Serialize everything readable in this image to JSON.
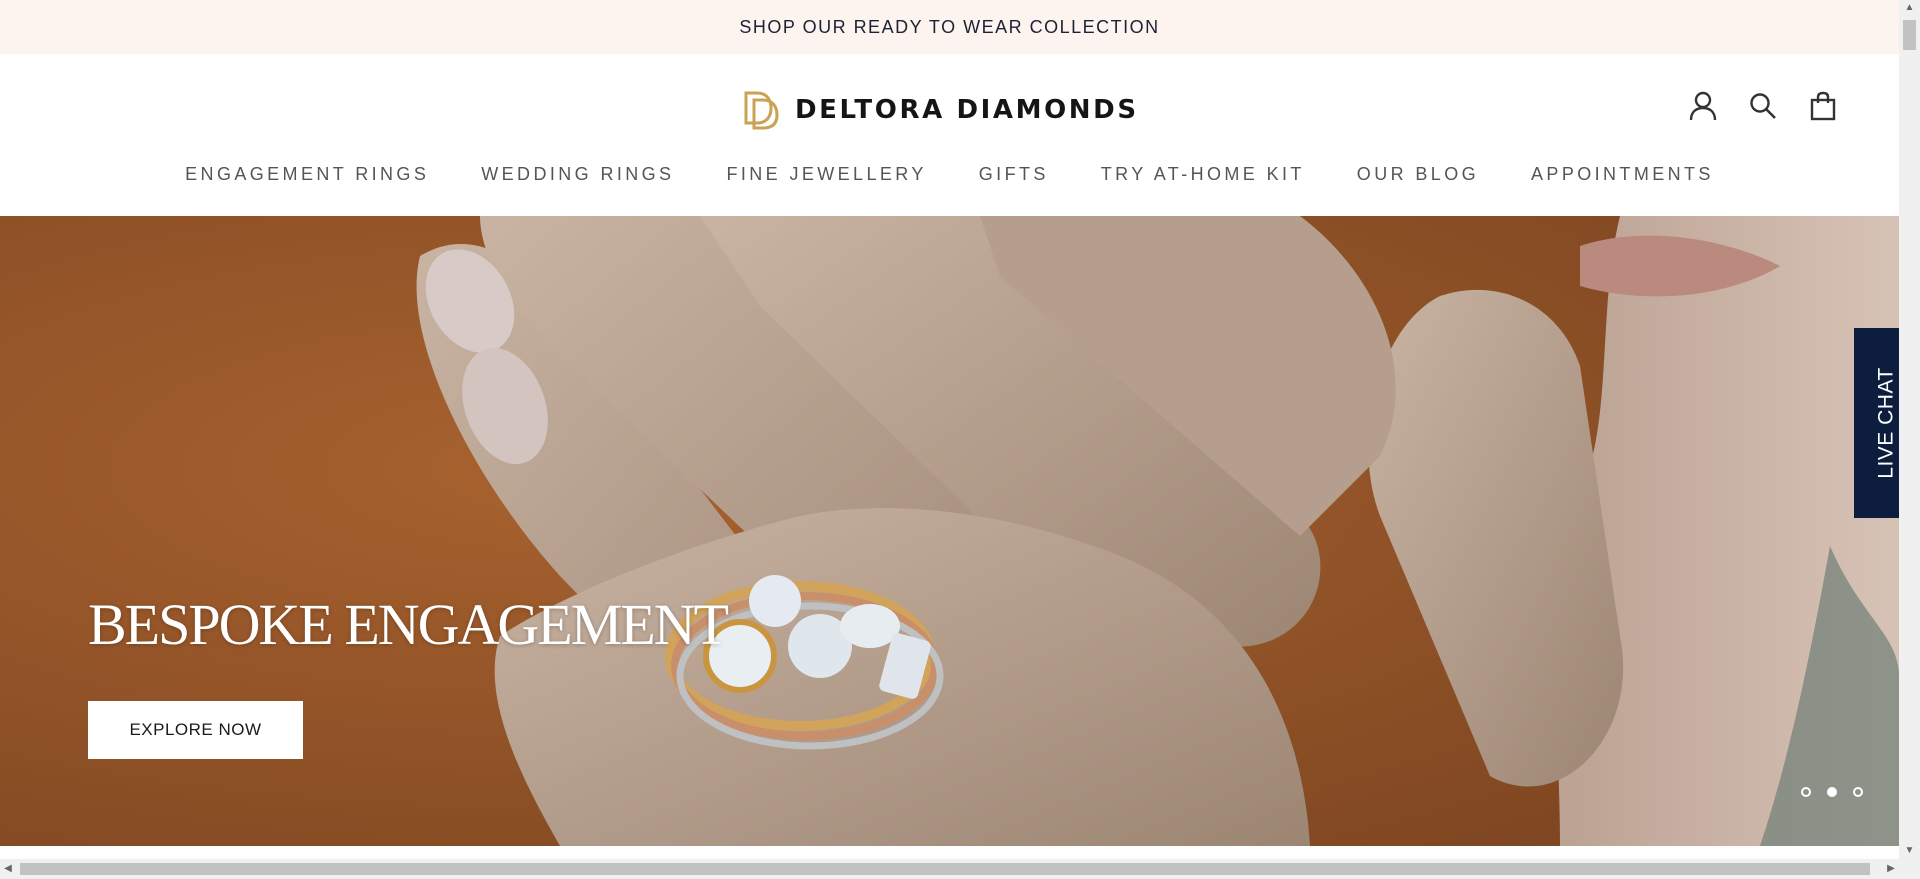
{
  "announcement": {
    "text": "SHOP OUR READY TO WEAR COLLECTION"
  },
  "header": {
    "logo_text": "DELTORA DIAMONDS",
    "icons": [
      "account-icon",
      "search-icon",
      "cart-icon"
    ]
  },
  "nav": {
    "items": [
      {
        "label": "ENGAGEMENT RINGS"
      },
      {
        "label": "WEDDING RINGS"
      },
      {
        "label": "FINE JEWELLERY"
      },
      {
        "label": "GIFTS"
      },
      {
        "label": "TRY AT-HOME KIT"
      },
      {
        "label": "OUR BLOG"
      },
      {
        "label": "APPOINTMENTS"
      }
    ]
  },
  "hero": {
    "title": "BESPOKE ENGAGEMENT",
    "cta": "EXPLORE NOW",
    "slides": 3,
    "active_slide": 2
  },
  "live_chat": {
    "label": "LIVE CHAT"
  },
  "colors": {
    "announcement_bg": "#fdf3ef",
    "logo_gold": "#c9a253",
    "hero_bg": "#9a5a2c",
    "live_chat_bg": "#0c1d3d"
  }
}
